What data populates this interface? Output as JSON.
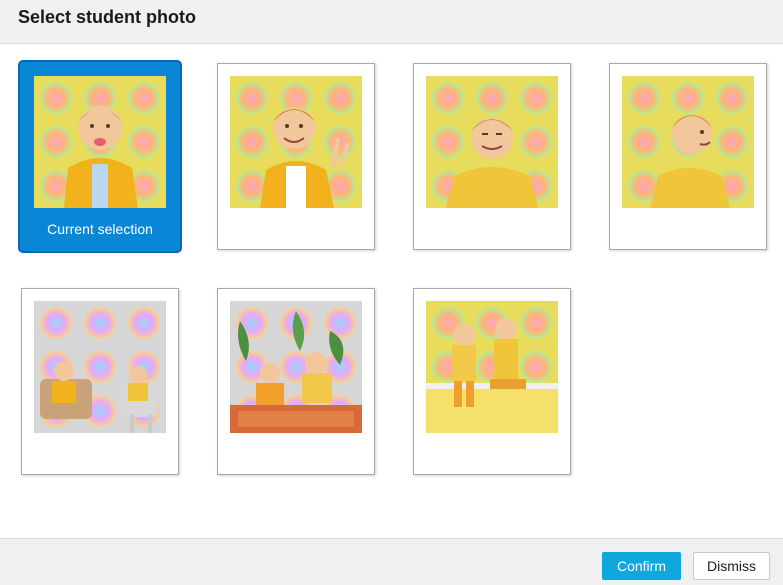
{
  "dialog": {
    "title": "Select student photo"
  },
  "photos": [
    {
      "id": "photo-1",
      "selected": true,
      "caption": "Current selection",
      "scene": "child-tongue-out"
    },
    {
      "id": "photo-2",
      "selected": false,
      "caption": "",
      "scene": "child-peace-sign"
    },
    {
      "id": "photo-3",
      "selected": false,
      "caption": "",
      "scene": "child-seated-smiling"
    },
    {
      "id": "photo-4",
      "selected": false,
      "caption": "",
      "scene": "child-looking-side"
    },
    {
      "id": "photo-5",
      "selected": false,
      "caption": "",
      "scene": "two-children-armchairs"
    },
    {
      "id": "photo-6",
      "selected": false,
      "caption": "",
      "scene": "children-playing-floor"
    },
    {
      "id": "photo-7",
      "selected": false,
      "caption": "",
      "scene": "two-children-on-bench"
    }
  ],
  "footer": {
    "confirm_label": "Confirm",
    "dismiss_label": "Dismiss"
  },
  "colors": {
    "accent": "#0a86d6",
    "confirm": "#0fa8de",
    "header_bg": "#eff0f2"
  }
}
